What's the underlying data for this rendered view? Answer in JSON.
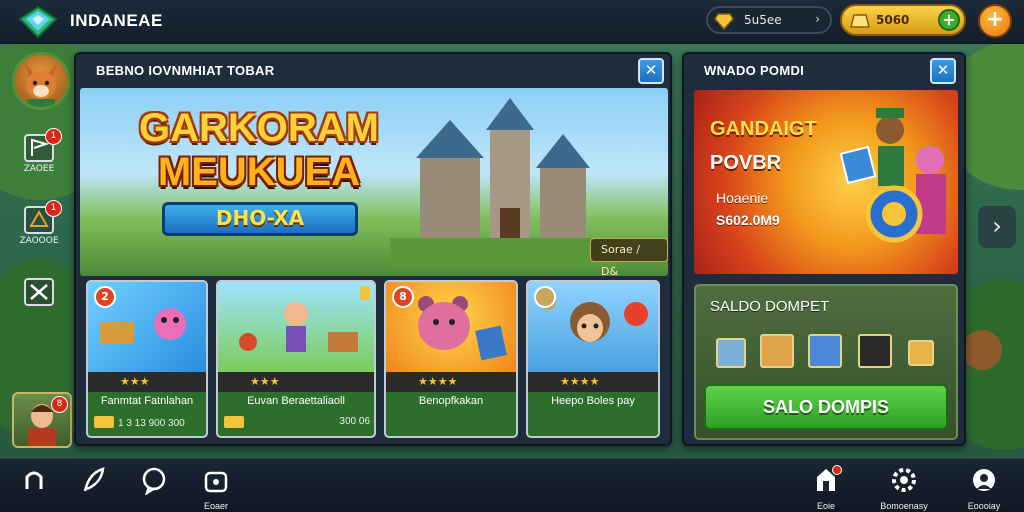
{
  "app": {
    "title": "INDANEAE"
  },
  "currency": {
    "gems_value": "5u5ee",
    "gold_value": "5060"
  },
  "left_rail": {
    "items": [
      {
        "label": "ZAOEE",
        "badge": "1"
      },
      {
        "label": "ZAOOOE",
        "badge": "1"
      }
    ],
    "hero_badge": "8"
  },
  "main_panel": {
    "title": "BEBNO IOVNMHIAT TOBAR",
    "banner": {
      "logo_line1": "GARKORAM",
      "logo_line2": "MEUKUEA",
      "logo_ribbon": "DHO-XA",
      "tag": "Sorae / D&"
    },
    "cards": [
      {
        "badge": "2",
        "stars": "★★★",
        "title": "Fanmtat Fatnlahan",
        "sub": "1 3 13 900 300"
      },
      {
        "badge": "",
        "stars": "★★★",
        "title": "Euvan Beraettaliaoll",
        "sub": "300 06"
      },
      {
        "badge": "8",
        "stars": "★★★★",
        "title": "Benopfkakan",
        "sub": ""
      },
      {
        "badge": "",
        "stars": "★★★★",
        "title": "Heepo Boles pay",
        "sub": ""
      }
    ]
  },
  "right_panel": {
    "title": "WNADO POMDI",
    "promo": {
      "line1": "GANDAIGT",
      "line2": "POVBR",
      "line3": "Hoaenie",
      "line4": "S602.0M9"
    },
    "wallet": {
      "title": "SALDO DOMPET",
      "button": "SALO DOMPIS"
    }
  },
  "bottom_nav": [
    {
      "label": "",
      "icon": "home-icon"
    },
    {
      "label": "",
      "icon": "feather-icon"
    },
    {
      "label": "",
      "icon": "chat-icon"
    },
    {
      "label": "Eoaer",
      "icon": "bag-icon"
    },
    {
      "label": "Eoie",
      "icon": "shop-icon"
    },
    {
      "label": "Bomoenasy",
      "icon": "gear-icon"
    },
    {
      "label": "Eoooiay",
      "icon": "profile-icon"
    }
  ]
}
